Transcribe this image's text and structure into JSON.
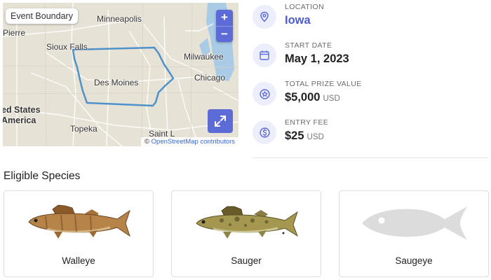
{
  "map": {
    "badge": "Event Boundary",
    "zoom_in": "+",
    "zoom_out": "−",
    "attribution_prefix": "©",
    "attribution_link": "OpenStreetMap contributors",
    "labels": {
      "minneapolis": "Minneapolis",
      "pierre": "Pierre",
      "sioux_falls": "Sioux Falls",
      "milwaukee": "Milwaukee",
      "des_moines": "Des Moines",
      "chicago": "Chicago",
      "united_states": "ed States",
      "america": "America",
      "topeka": "Topeka",
      "saint_l": "Saint L"
    }
  },
  "details": {
    "location": {
      "label": "LOCATION",
      "value": "Iowa",
      "icon": "location-pin-icon"
    },
    "start_date": {
      "label": "START DATE",
      "value": "May 1, 2023",
      "icon": "calendar-icon"
    },
    "prize": {
      "label": "TOTAL PRIZE VALUE",
      "value": "$5,000",
      "unit": "USD",
      "icon": "award-icon"
    },
    "entry_fee": {
      "label": "ENTRY FEE",
      "value": "$25",
      "unit": "USD",
      "icon": "dollar-coin-icon"
    }
  },
  "species": {
    "title": "Eligible Species",
    "items": [
      {
        "name": "Walleye"
      },
      {
        "name": "Sauger"
      },
      {
        "name": "Saugeye"
      }
    ]
  },
  "colors": {
    "accent": "#5c6bd6",
    "boundary": "#4f91c9",
    "lake": "#a9cbe6",
    "icon_bg": "#eceefb"
  }
}
